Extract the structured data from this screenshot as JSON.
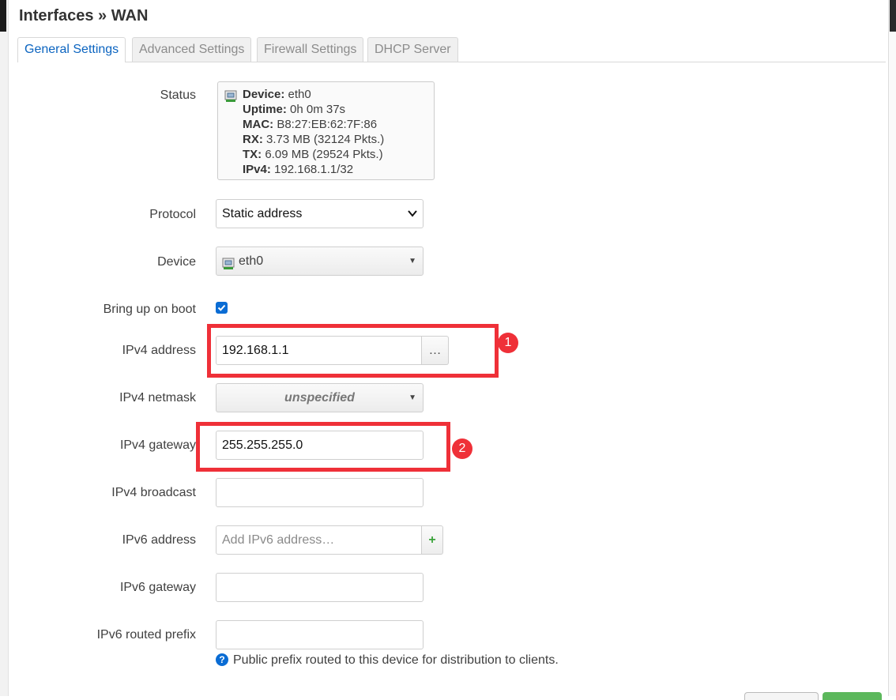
{
  "dialog": {
    "title": "Interfaces » WAN"
  },
  "tabs": [
    {
      "label": "General Settings",
      "active": true
    },
    {
      "label": "Advanced Settings",
      "active": false
    },
    {
      "label": "Firewall Settings",
      "active": false
    },
    {
      "label": "DHCP Server",
      "active": false
    }
  ],
  "status": {
    "label": "Status",
    "icon": "ethernet-port-icon",
    "lines": [
      {
        "key": "Device:",
        "value": " eth0"
      },
      {
        "key": "Uptime:",
        "value": " 0h 0m 37s"
      },
      {
        "key": "MAC:",
        "value": " B8:27:EB:62:7F:86"
      },
      {
        "key": "RX:",
        "value": " 3.73 MB (32124 Pkts.)"
      },
      {
        "key": "TX:",
        "value": " 6.09 MB (29524 Pkts.)"
      },
      {
        "key": "IPv4:",
        "value": " 192.168.1.1/32"
      }
    ]
  },
  "fields": {
    "protocol": {
      "label": "Protocol",
      "value": "Static address"
    },
    "device": {
      "label": "Device",
      "value": "eth0",
      "icon": "ethernet-port-icon"
    },
    "bring_up_on_boot": {
      "label": "Bring up on boot",
      "checked": true
    },
    "ipv4_address": {
      "label": "IPv4 address",
      "value": "192.168.1.1",
      "addon": "…"
    },
    "ipv4_netmask": {
      "label": "IPv4 netmask",
      "value": "unspecified"
    },
    "ipv4_gateway": {
      "label": "IPv4 gateway",
      "value": "255.255.255.0"
    },
    "ipv4_broadcast": {
      "label": "IPv4 broadcast",
      "value": ""
    },
    "ipv6_address": {
      "label": "IPv6 address",
      "placeholder": "Add IPv6 address…",
      "addon": "+"
    },
    "ipv6_gateway": {
      "label": "IPv6 gateway",
      "value": ""
    },
    "ipv6_routed_prefix": {
      "label": "IPv6 routed prefix",
      "value": "",
      "help": "Public prefix routed to this device for distribution to clients."
    }
  },
  "annotations": [
    {
      "number": "1"
    },
    {
      "number": "2"
    }
  ],
  "colors": {
    "accent": "#0a6cd4",
    "annotation": "#ef3038",
    "save_button": "#5cb85c"
  }
}
